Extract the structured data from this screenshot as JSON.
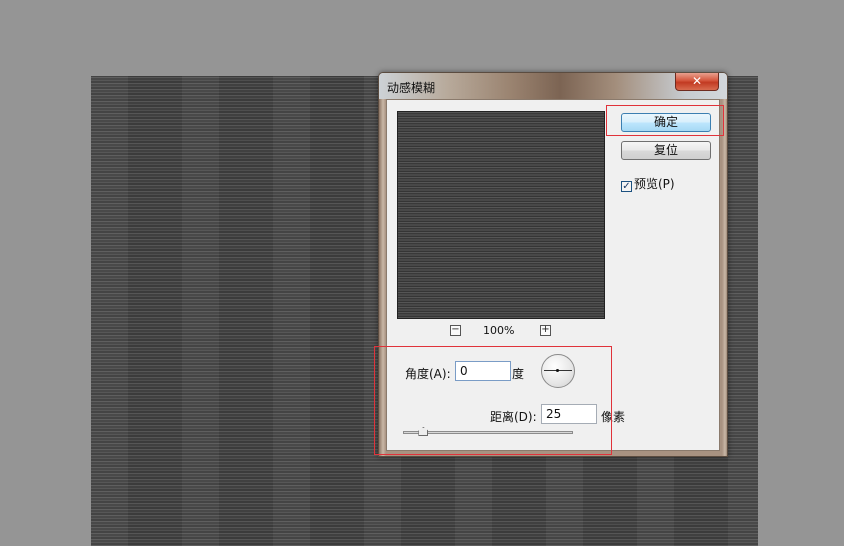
{
  "dialog": {
    "title": "动感模糊",
    "close_glyph": "✕"
  },
  "buttons": {
    "ok_label": "确定",
    "reset_label": "复位"
  },
  "preview_option": {
    "checked": true,
    "label": "预览(P)"
  },
  "zoom": {
    "minus_glyph": "−",
    "plus_glyph": "+",
    "level": "100%"
  },
  "angle": {
    "label": "角度(A):",
    "value": "0",
    "unit": "度"
  },
  "distance": {
    "label": "距离(D):",
    "value": "25",
    "unit": "像素",
    "slider_fraction": 0.12
  },
  "colors": {
    "annotation_red": "#e0323a",
    "ok_button_blue": "#bde6fd"
  }
}
